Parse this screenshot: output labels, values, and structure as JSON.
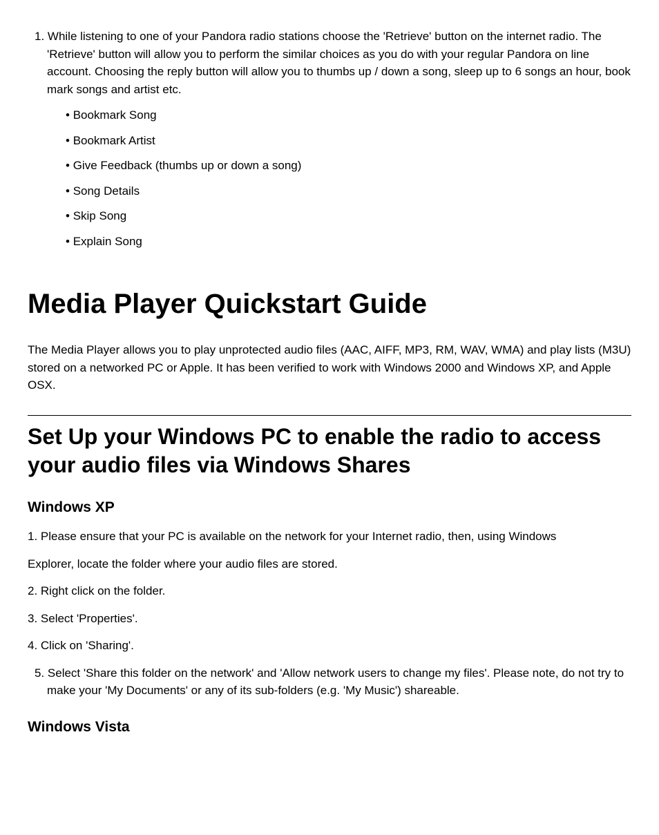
{
  "pandora": {
    "step1": "1. While listening to one of your Pandora radio stations choose the 'Retrieve' button on the internet radio. The 'Retrieve' button will allow you to perform the similar choices as you do with your regular Pandora on line account. Choosing the reply button will allow you to thumbs up / down a song, sleep up to 6 songs an hour, book mark songs and artist etc.",
    "bullets": [
      "Bookmark Song",
      "Bookmark Artist",
      "Give Feedback (thumbs up or down a song)",
      "Song Details",
      "Skip Song",
      "Explain Song"
    ]
  },
  "h1": "Media Player Quickstart Guide",
  "mediaIntro": "The Media Player allows you to play unprotected audio files (AAC, AIFF, MP3, RM, WAV, WMA) and play lists (M3U) stored on a networked PC or Apple. It has been verified to work with Windows 2000 and Windows XP, and Apple OSX.",
  "h2": "Set Up your Windows PC to enable the radio to access your audio files via Windows Shares",
  "xp": {
    "heading": "Windows XP",
    "step1a": "1. Please ensure that your PC is available on the network for your Internet radio, then, using Windows",
    "step1b": "Explorer, locate the folder where your audio files are stored.",
    "step2": "2. Right click on the folder.",
    "step3": "3. Select 'Properties'.",
    "step4": "4. Click on 'Sharing'.",
    "step5": "5. Select 'Share this folder on the network' and 'Allow network users to change my files'. Please note, do not try to make your 'My Documents' or any of its sub-folders (e.g. 'My Music') shareable."
  },
  "vista": {
    "heading": "Windows Vista"
  }
}
